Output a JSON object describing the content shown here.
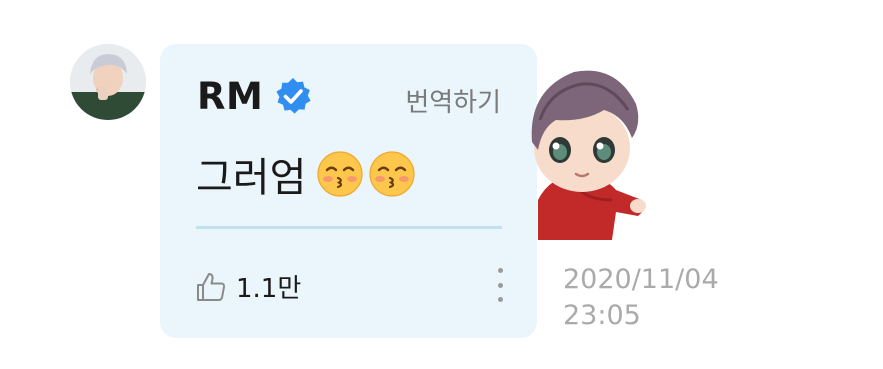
{
  "post": {
    "author": "RM",
    "verified_icon": "verified-badge-icon",
    "translate_label": "번역하기",
    "message_text": "그러엄",
    "emojis": [
      "kissing-smiling-eyes-emoji",
      "kissing-smiling-eyes-emoji"
    ],
    "likes": {
      "icon": "thumbs-up-icon",
      "count": "1.1만"
    },
    "more_icon": "more-vertical-icon",
    "timestamp": {
      "date": "2020/11/04",
      "time": "23:05"
    },
    "sticker": "character-sticker"
  },
  "colors": {
    "bubble_bg": "#eaf6fc",
    "verified_blue": "#2f8ef0",
    "divider": "#bfe2ee",
    "muted_text": "#7a7a7a",
    "timestamp_text": "#aaaaaa"
  }
}
